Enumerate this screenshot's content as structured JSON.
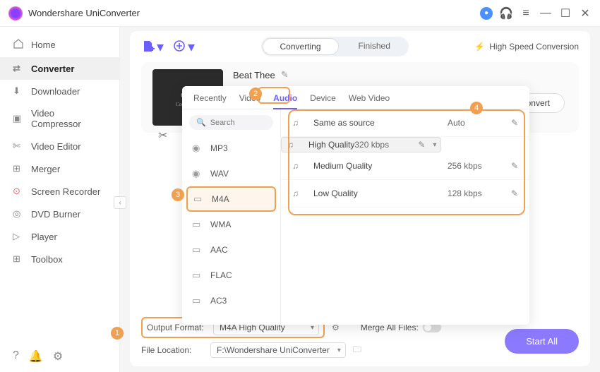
{
  "window": {
    "title": "Wondershare UniConverter"
  },
  "sidebar": {
    "items": [
      {
        "label": "Home",
        "icon": "⌂"
      },
      {
        "label": "Converter",
        "icon": "⇄",
        "active": true
      },
      {
        "label": "Downloader",
        "icon": "↓"
      },
      {
        "label": "Video Compressor",
        "icon": "▭"
      },
      {
        "label": "Video Editor",
        "icon": "✂"
      },
      {
        "label": "Merger",
        "icon": "⊞"
      },
      {
        "label": "Screen Recorder",
        "icon": "⊙",
        "dot": true
      },
      {
        "label": "DVD Burner",
        "icon": "◎"
      },
      {
        "label": "Player",
        "icon": "▷"
      },
      {
        "label": "Toolbox",
        "icon": "⊞"
      }
    ]
  },
  "segment": {
    "converting": "Converting",
    "finished": "Finished"
  },
  "hsc": "High Speed Conversion",
  "file": {
    "name": "Beat Thee"
  },
  "convert": "Convert",
  "popup": {
    "tabs": [
      "Recently",
      "Video",
      "Audio",
      "Device",
      "Web Video"
    ],
    "active_tab": "Audio",
    "search_placeholder": "Search",
    "formats": [
      "MP3",
      "WAV",
      "M4A",
      "WMA",
      "AAC",
      "FLAC",
      "AC3"
    ],
    "active_format": "M4A",
    "qualities": [
      {
        "name": "Same as source",
        "rate": "Auto"
      },
      {
        "name": "High Quality",
        "rate": "320 kbps",
        "selected": true
      },
      {
        "name": "Medium Quality",
        "rate": "256 kbps"
      },
      {
        "name": "Low Quality",
        "rate": "128 kbps"
      }
    ]
  },
  "footer": {
    "output_label": "Output Format:",
    "output_value": "M4A High Quality",
    "location_label": "File Location:",
    "location_value": "F:\\Wondershare UniConverter",
    "merge_label": "Merge All Files:",
    "startall": "Start All"
  },
  "callouts": {
    "1": "1",
    "2": "2",
    "3": "3",
    "4": "4"
  }
}
